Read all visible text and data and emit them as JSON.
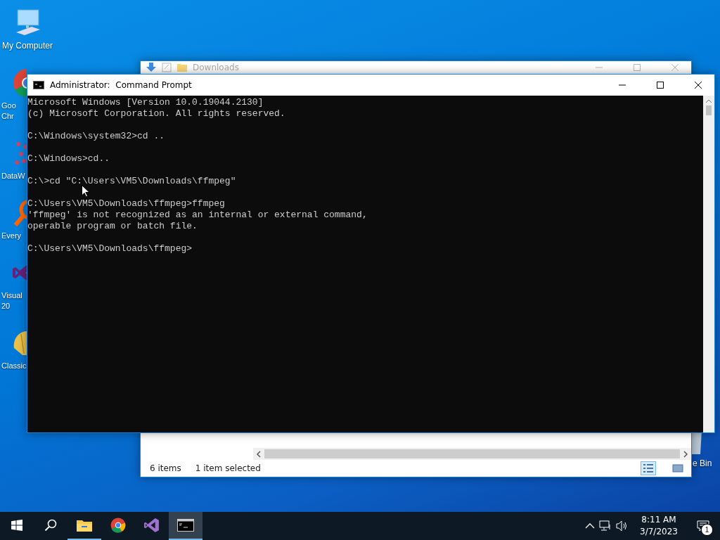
{
  "desktop": {
    "icons": [
      {
        "kind": "computer",
        "lines": [
          "My Computer"
        ]
      },
      {
        "kind": "chrome",
        "lines": [
          "Goo",
          "Chr"
        ]
      },
      {
        "kind": "data",
        "lines": [
          "DataW"
        ]
      },
      {
        "kind": "everything",
        "lines": [
          "Every"
        ]
      },
      {
        "kind": "vs",
        "lines": [
          "Visual",
          "20"
        ]
      },
      {
        "kind": "shell",
        "lines": [
          "Classic"
        ]
      }
    ],
    "recycle_bin": {
      "label": "e Bin"
    }
  },
  "explorer": {
    "title": "Downloads",
    "status_count": "6 items",
    "status_selected": "1 item selected"
  },
  "cmd": {
    "title": "Administrator:  Command Prompt",
    "blocks": [
      [
        "Microsoft Windows [Version 10.0.19044.2130]",
        "(c) Microsoft Corporation. All rights reserved."
      ],
      [
        "C:\\Windows\\system32>cd .."
      ],
      [
        "C:\\Windows>cd.."
      ],
      [
        "C:\\>cd \"C:\\Users\\VM5\\Downloads\\ffmpeg\""
      ],
      [
        "C:\\Users\\VM5\\Downloads\\ffmpeg>ffmpeg",
        "'ffmpeg' is not recognized as an internal or external command,",
        "operable program or batch file."
      ],
      [
        "C:\\Users\\VM5\\Downloads\\ffmpeg>"
      ]
    ]
  },
  "taskbar": {
    "apps": [
      {
        "kind": "start",
        "running": false,
        "selected": false
      },
      {
        "kind": "search",
        "running": false,
        "selected": false
      },
      {
        "kind": "explorer",
        "running": true,
        "selected": false
      },
      {
        "kind": "chrome",
        "running": false,
        "selected": false
      },
      {
        "kind": "vs",
        "running": false,
        "selected": false
      },
      {
        "kind": "cmd",
        "running": true,
        "selected": true
      }
    ],
    "time": "8:11 AM",
    "date": "3/7/2023",
    "notification_count": "1"
  }
}
